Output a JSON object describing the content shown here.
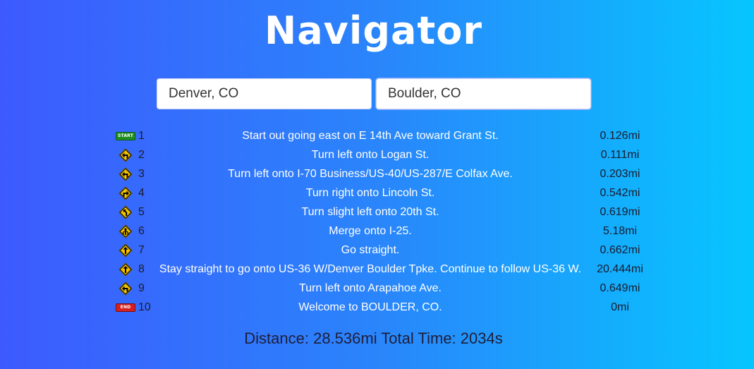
{
  "app": {
    "title": "Navigator"
  },
  "inputs": {
    "from_value": "Denver, CO",
    "to_value": "Boulder, CO"
  },
  "steps": [
    {
      "num": "1",
      "icon": "start-badge-icon",
      "icon_text": "START",
      "text": "Start out going east on E 14th Ave toward Grant St.",
      "distance": "0.126mi"
    },
    {
      "num": "2",
      "icon": "turn-left-sign-icon",
      "text": "Turn left onto Logan St.",
      "distance": "0.111mi"
    },
    {
      "num": "3",
      "icon": "turn-left-sign-icon",
      "text": "Turn left onto I-70 Business/US-40/US-287/E Colfax Ave.",
      "distance": "0.203mi"
    },
    {
      "num": "4",
      "icon": "turn-right-sign-icon",
      "text": "Turn right onto Lincoln St.",
      "distance": "0.542mi"
    },
    {
      "num": "5",
      "icon": "slight-left-sign-icon",
      "text": "Turn slight left onto 20th St.",
      "distance": "0.619mi"
    },
    {
      "num": "6",
      "icon": "merge-sign-icon",
      "text": "Merge onto I-25.",
      "distance": "5.18mi"
    },
    {
      "num": "7",
      "icon": "straight-sign-icon",
      "text": "Go straight.",
      "distance": "0.662mi"
    },
    {
      "num": "8",
      "icon": "straight-sign-icon",
      "text": "Stay straight to go onto US-36 W/Denver Boulder Tpke. Continue to follow US-36 W.",
      "distance": "20.444mi"
    },
    {
      "num": "9",
      "icon": "turn-left-sign-icon",
      "text": "Turn left onto Arapahoe Ave.",
      "distance": "0.649mi"
    },
    {
      "num": "10",
      "icon": "end-badge-icon",
      "icon_text": "END",
      "text": "Welcome to BOULDER, CO.",
      "distance": "0mi"
    }
  ],
  "summary": {
    "text": "Distance: 28.536mi Total Time: 2034s"
  },
  "colors": {
    "sign_fill": "#f5c400",
    "sign_border": "#000000",
    "start_badge": "#1f8f22",
    "end_badge": "#d81f1f"
  }
}
